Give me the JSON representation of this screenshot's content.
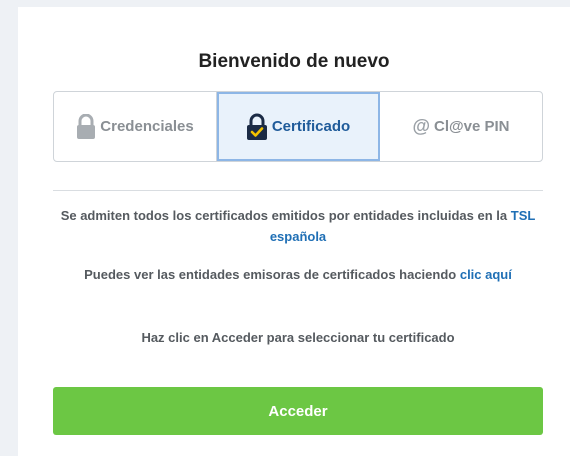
{
  "title": "Bienvenido de nuevo",
  "tabs": [
    {
      "label": "Credenciales",
      "icon": "padlock-icon"
    },
    {
      "label": "Certificado",
      "icon": "certificate-lock-icon",
      "active": true
    },
    {
      "label": "Cl@ve PIN",
      "icon": "at-icon"
    }
  ],
  "info": {
    "line1_text": "Se admiten todos los certificados emitidos por entidades incluidas en la ",
    "line1_link": "TSL española",
    "line2_text": "Puedes ver las entidades emisoras de certificados haciendo ",
    "line2_link": "clic aquí",
    "line3_text": "Haz clic en Acceder para seleccionar tu certificado"
  },
  "button": {
    "label": "Acceder"
  },
  "colors": {
    "primary_button": "#6cc744",
    "link": "#1f6fb5",
    "active_tab_bg": "#e9f2fb",
    "active_tab_text": "#1f5b9a"
  }
}
